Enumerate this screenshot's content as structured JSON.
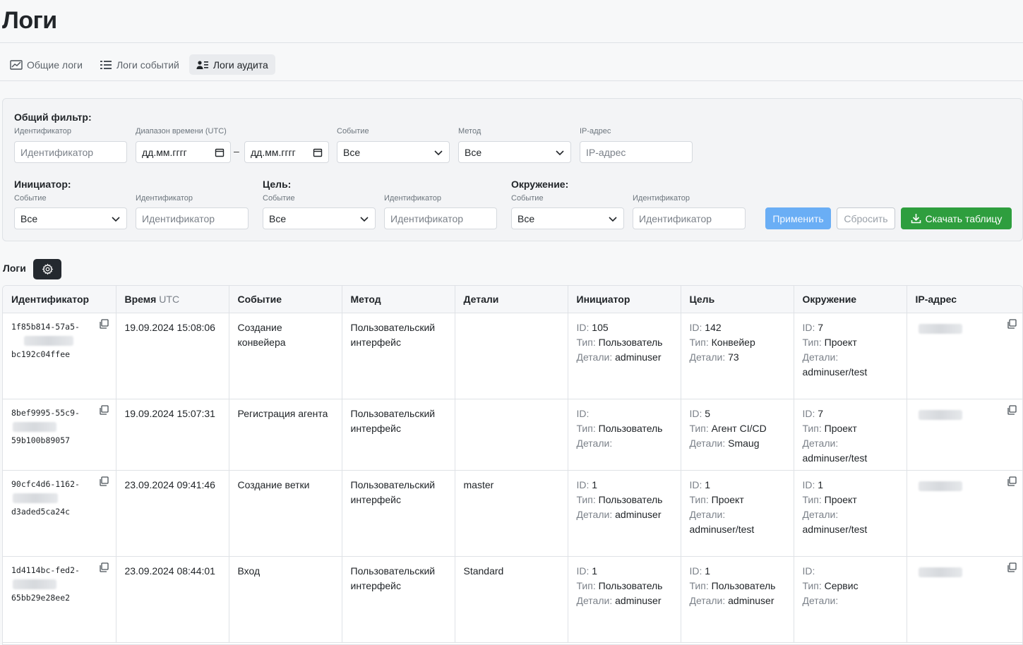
{
  "page": {
    "title": "Логи"
  },
  "tabs": [
    {
      "label": "Общие логи",
      "icon": "chart-icon",
      "active": false
    },
    {
      "label": "Логи событий",
      "icon": "list-icon",
      "active": false
    },
    {
      "label": "Логи аудита",
      "icon": "user-list-icon",
      "active": true
    }
  ],
  "filter": {
    "general": {
      "title": "Общий фильтр:",
      "id_label": "Идентификатор",
      "id_placeholder": "Идентификатор",
      "time_label": "Диапазон времени (UTC)",
      "date_from": "дд.мм.гггг",
      "date_to": "дд.мм.гггг",
      "dash": "–",
      "event_label": "Событие",
      "event_value": "Все",
      "method_label": "Метод",
      "method_value": "Все",
      "ip_label": "IP-адрес",
      "ip_placeholder": "IP-адрес"
    },
    "initiator": {
      "title": "Инициатор:",
      "event_label": "Событие",
      "event_value": "Все",
      "id_label": "Идентификатор",
      "id_placeholder": "Идентификатор"
    },
    "target": {
      "title": "Цель:",
      "event_label": "Событие",
      "event_value": "Все",
      "id_label": "Идентификатор",
      "id_placeholder": "Идентификатор"
    },
    "environment": {
      "title": "Окружение:",
      "event_label": "Событие",
      "event_value": "Все",
      "id_label": "Идентификатор",
      "id_placeholder": "Идентификатор"
    },
    "buttons": {
      "apply": "Применить",
      "reset": "Сбросить",
      "download": "Скачать таблицу"
    }
  },
  "logs": {
    "label": "Логи",
    "columns": {
      "id": "Идентификатор",
      "time": "Время",
      "time_unit": "UTC",
      "event": "Событие",
      "method": "Метод",
      "details": "Детали",
      "initiator": "Инициатор",
      "target": "Цель",
      "environment": "Окружение",
      "ip": "IP-адрес"
    },
    "field_labels": {
      "id": "ID:",
      "type": "Тип:",
      "details": "Детали:"
    },
    "rows": [
      {
        "id_top": "1f85b814-57a5-",
        "id_bottom": "bc192c04ffee",
        "time": "19.09.2024 15:08:06",
        "event": "Создание конвейера",
        "method": "Пользовательский интерфейс",
        "details": "",
        "initiator": {
          "id": "105",
          "type": "Пользователь",
          "details": "adminuser"
        },
        "target": {
          "id": "142",
          "type": "Конвейер",
          "details": "73"
        },
        "environment": {
          "id": "7",
          "type": "Проект",
          "details": "adminuser/test"
        }
      },
      {
        "id_top": "8bef9995-55c9-",
        "id_bottom": "59b100b89057",
        "time": "19.09.2024 15:07:31",
        "event": "Регистрация агента",
        "method": "Пользовательский интерфейс",
        "details": "",
        "initiator": {
          "id": "",
          "type": "Пользователь",
          "details": ""
        },
        "target": {
          "id": "5",
          "type": "Агент CI/CD",
          "details": "Smaug"
        },
        "environment": {
          "id": "7",
          "type": "Проект",
          "details": "adminuser/test"
        }
      },
      {
        "id_top": "90cfc4d6-1162-",
        "id_bottom": "d3aded5ca24c",
        "time": "23.09.2024 09:41:46",
        "event": "Создание ветки",
        "method": "Пользовательский интерфейс",
        "details": "master",
        "initiator": {
          "id": "1",
          "type": "Пользователь",
          "details": "adminuser"
        },
        "target": {
          "id": "1",
          "type": "Проект",
          "details": "adminuser/test"
        },
        "environment": {
          "id": "1",
          "type": "Проект",
          "details": "adminuser/test"
        }
      },
      {
        "id_top": "1d4114bc-fed2-",
        "id_bottom": "65bb29e28ee2",
        "time": "23.09.2024 08:44:01",
        "event": "Вход",
        "method": "Пользовательский интерфейс",
        "details": "Standard",
        "initiator": {
          "id": "1",
          "type": "Пользователь",
          "details": "adminuser"
        },
        "target": {
          "id": "1",
          "type": "Пользователь",
          "details": "adminuser"
        },
        "environment": {
          "id": "",
          "type": "Сервис",
          "details": ""
        }
      }
    ]
  }
}
